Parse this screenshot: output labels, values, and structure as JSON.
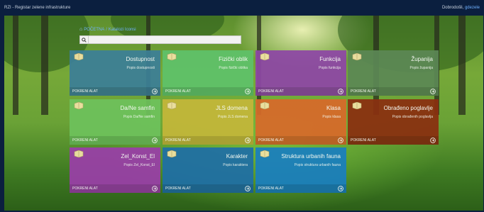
{
  "header": {
    "title": "RZI - Registar zelene infrastrukture",
    "greeting": "Dobrodošli,",
    "username": "gdezele"
  },
  "breadcrumb": {
    "home": "POČETNA",
    "separator": "/",
    "current": "Katalozi Iconsi"
  },
  "search": {
    "placeholder": ""
  },
  "tiles": [
    {
      "title": "Dostupnost",
      "sub": "Popis dostupnosti",
      "action": "POKRENI ALAT",
      "color": "#3c7f97"
    },
    {
      "title": "Fizički oblik",
      "sub": "Popis fizički oblika",
      "action": "POKRENI ALAT",
      "color": "#5fc26a"
    },
    {
      "title": "Funkcija",
      "sub": "Popis funkcija",
      "action": "POKRENI ALAT",
      "color": "#8e47a6"
    },
    {
      "title": "Županija",
      "sub": "Popis županija",
      "action": "POKRENI ALAT",
      "color": "#5c8855"
    },
    {
      "title": "Da/Ne samfin",
      "sub": "Popis Da/Ne samfin",
      "action": "POKRENI ALAT",
      "color": "#6ec25c"
    },
    {
      "title": "JLS domena",
      "sub": "Popis JLS domena",
      "action": "POKRENI ALAT",
      "color": "#c4b73a"
    },
    {
      "title": "Klasa",
      "sub": "Popis klasa",
      "action": "POKRENI ALAT",
      "color": "#d86a2a"
    },
    {
      "title": "Obrađeno poglavlje",
      "sub": "Popis obrađenih poglavlja",
      "action": "POKRENI ALAT",
      "color": "#8a2f10"
    },
    {
      "title": "Zel_Konst_El",
      "sub": "Popis Zel_Konst_El",
      "action": "POKRENI ALAT",
      "color": "#9a3fa8"
    },
    {
      "title": "Karakter",
      "sub": "Popis karaktera",
      "action": "POKRENI ALAT",
      "color": "#1f6fa6"
    },
    {
      "title": "Struktura urbanih fauna",
      "sub": "Popis struktura urbanih fauna",
      "action": "POKRENI ALAT",
      "color": "#1a7fbf"
    }
  ],
  "icons": {
    "tile_icon": "book-icon",
    "action_icon": "arrow-circle-icon",
    "search_icon": "search-icon",
    "home_icon": "home-icon"
  }
}
